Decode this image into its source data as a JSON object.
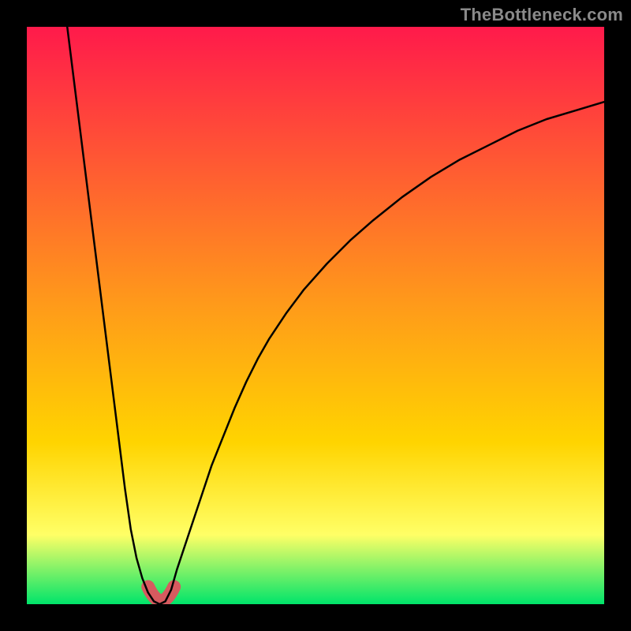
{
  "watermark": "TheBottleneck.com",
  "colors": {
    "frame": "#000000",
    "gradient_top": "#ff1a4b",
    "gradient_mid": "#ffd400",
    "gradient_low": "#ffff66",
    "gradient_bottom": "#00e46a",
    "curve": "#000000",
    "accent": "#d65a5f"
  },
  "chart_data": {
    "type": "line",
    "title": "",
    "xlabel": "",
    "ylabel": "",
    "xlim": [
      0,
      100
    ],
    "ylim": [
      0,
      100
    ],
    "grid": false,
    "series": [
      {
        "name": "bottleneck-curve",
        "x": [
          7,
          8,
          9,
          10,
          11,
          12,
          13,
          14,
          15,
          16,
          17,
          18,
          19,
          20,
          21,
          22,
          23,
          24,
          25,
          26,
          28,
          30,
          32,
          34,
          36,
          38,
          40,
          42,
          45,
          48,
          52,
          56,
          60,
          65,
          70,
          75,
          80,
          85,
          90,
          95,
          100
        ],
        "values": [
          100,
          92,
          84,
          76,
          68,
          60,
          52,
          44,
          36,
          28,
          20,
          13,
          8,
          4.5,
          2,
          0.5,
          0,
          0.5,
          2.5,
          6,
          12,
          18,
          24,
          29,
          34,
          38.5,
          42.5,
          46,
          50.5,
          54.5,
          59,
          63,
          66.5,
          70.5,
          74,
          77,
          79.5,
          82,
          84,
          85.5,
          87
        ]
      }
    ],
    "accent_region": {
      "note": "highlighted minimum of the curve",
      "x_range": [
        21,
        25.5
      ],
      "y_range": [
        0,
        3
      ]
    },
    "legend": null
  }
}
